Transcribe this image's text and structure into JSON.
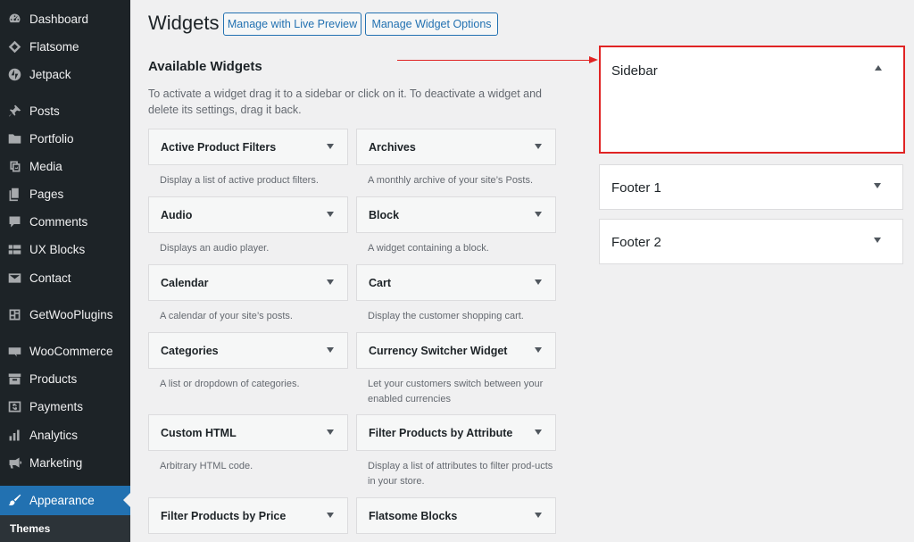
{
  "menu": {
    "items": [
      {
        "label": "Dashboard",
        "icon": "dashboard-icon"
      },
      {
        "label": "Flatsome",
        "icon": "flatsome-icon"
      },
      {
        "label": "Jetpack",
        "icon": "jetpack-icon"
      },
      {
        "label": "Posts",
        "icon": "pin-icon"
      },
      {
        "label": "Portfolio",
        "icon": "folder-icon"
      },
      {
        "label": "Media",
        "icon": "media-icon"
      },
      {
        "label": "Pages",
        "icon": "pages-icon"
      },
      {
        "label": "Comments",
        "icon": "comments-icon"
      },
      {
        "label": "UX Blocks",
        "icon": "blocks-icon"
      },
      {
        "label": "Contact",
        "icon": "mail-icon"
      },
      {
        "label": "GetWooPlugins",
        "icon": "plugin-icon"
      },
      {
        "label": "WooCommerce",
        "icon": "woo-icon"
      },
      {
        "label": "Products",
        "icon": "archive-icon"
      },
      {
        "label": "Payments",
        "icon": "dollar-icon"
      },
      {
        "label": "Analytics",
        "icon": "chart-bar-icon"
      },
      {
        "label": "Marketing",
        "icon": "megaphone-icon"
      },
      {
        "label": "Appearance",
        "icon": "brush-icon"
      }
    ],
    "submenu": "Themes"
  },
  "header": {
    "title": "Widgets",
    "live_preview_label": "Manage with Live Preview",
    "options_label": "Manage Widget Options"
  },
  "available": {
    "title": "Available Widgets",
    "description": "To activate a widget drag it to a sidebar or click on it. To deactivate a widget and delete its settings, drag it back."
  },
  "widgets": [
    {
      "title": "Active Product Filters",
      "desc": "Display a list of active product filters."
    },
    {
      "title": "Archives",
      "desc": "A monthly archive of your site’s Posts."
    },
    {
      "title": "Audio",
      "desc": "Displays an audio player."
    },
    {
      "title": "Block",
      "desc": "A widget containing a block."
    },
    {
      "title": "Calendar",
      "desc": "A calendar of your site’s posts."
    },
    {
      "title": "Cart",
      "desc": "Display the customer shopping cart."
    },
    {
      "title": "Categories",
      "desc": "A list or dropdown of categories."
    },
    {
      "title": "Currency Switcher Widget",
      "desc": "Let your customers switch between your enabled currencies"
    },
    {
      "title": "Custom HTML",
      "desc": "Arbitrary HTML code."
    },
    {
      "title": "Filter Products by Attribute",
      "desc": "Display a list of attributes to filter prod-ucts in your store."
    },
    {
      "title": "Filter Products by Price",
      "desc": ""
    },
    {
      "title": "Flatsome Blocks",
      "desc": ""
    }
  ],
  "sidebars": [
    {
      "title": "Sidebar"
    },
    {
      "title": "Footer 1"
    },
    {
      "title": "Footer 2"
    }
  ],
  "colors": {
    "menu_bg": "#1d2327",
    "menu_current": "#2271b1",
    "accent": "#2271b1",
    "highlight": "#e02424"
  }
}
